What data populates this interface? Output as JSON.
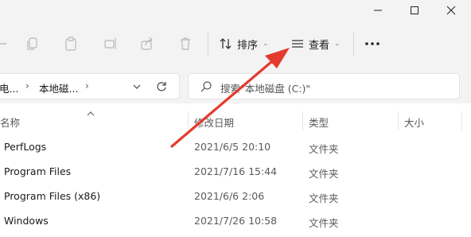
{
  "window": {
    "minimize_icon": "minimize-icon",
    "maximize_icon": "maximize-icon",
    "close_icon": "close-icon"
  },
  "toolbar": {
    "sort_label": "排序",
    "view_label": "查看",
    "more_icon": "more-icon"
  },
  "address": {
    "crumbs": [
      "电...",
      "本地磁..."
    ]
  },
  "search": {
    "placeholder": "搜索\"本地磁盘 (C:)\""
  },
  "columns": {
    "name": "名称",
    "date": "修改日期",
    "type": "类型",
    "size": "大小"
  },
  "rows": [
    {
      "name": "PerfLogs",
      "date": "2021/6/5 20:10",
      "type": "文件夹"
    },
    {
      "name": "Program Files",
      "date": "2021/7/16 15:44",
      "type": "文件夹"
    },
    {
      "name": "Program Files (x86)",
      "date": "2021/6/6 2:06",
      "type": "文件夹"
    },
    {
      "name": "Windows",
      "date": "2021/7/26 10:58",
      "type": "文件夹"
    }
  ],
  "colors": {
    "annotation_arrow": "#e23b2e",
    "background": "#f3f3f3",
    "list_background": "#ffffff"
  }
}
